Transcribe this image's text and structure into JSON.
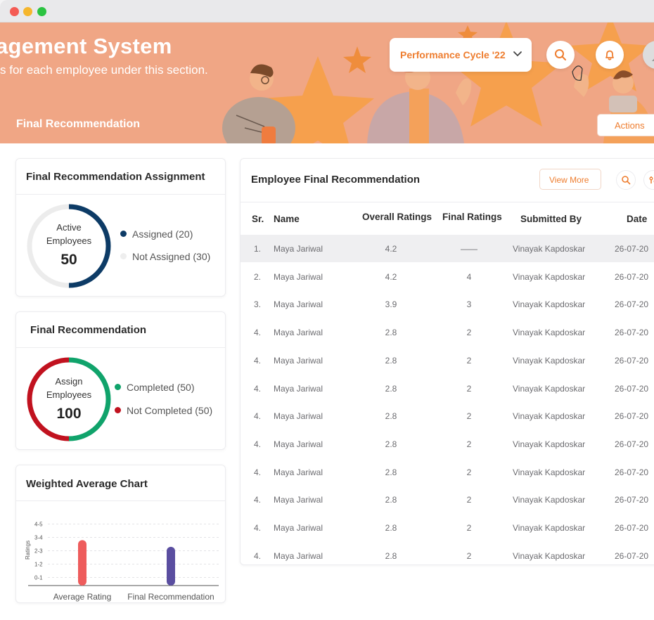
{
  "window": {
    "dots": [
      "#f45b54",
      "#f5b62d",
      "#2bc341"
    ]
  },
  "hero": {
    "title": "agement System",
    "subtitle": "s for each employee under this section.",
    "section_title": "Final Recommendation",
    "cycle_label": "Performance Cycle '22",
    "actions_label": "Actions"
  },
  "assignment": {
    "title": "Final Recommendation Assignment",
    "center_label_1": "Active",
    "center_label_2": "Employees",
    "center_value": "50",
    "legend": [
      {
        "label": "Assigned (20)",
        "color": "#0d3b66"
      },
      {
        "label": "Not Assigned (30)",
        "color": "#eeeeee"
      }
    ],
    "assigned_fraction": 0.5
  },
  "recommendation": {
    "title": "Final Recommendation",
    "center_label_1": "Assign",
    "center_label_2": "Employees",
    "center_value": "100",
    "legend": [
      {
        "label": "Completed (50)",
        "color": "#10a36b"
      },
      {
        "label": "Not Completed (50)",
        "color": "#c1121f"
      }
    ],
    "completed_fraction": 0.5
  },
  "weighted": {
    "title": "Weighted Average Chart"
  },
  "chart_data": {
    "type": "bar",
    "categories": [
      "Average Rating",
      "Final Recommendation"
    ],
    "values": [
      3.4,
      2.9
    ],
    "colors": [
      "#ee5c5c",
      "#5a4ea0"
    ],
    "ylabel": "Ratings",
    "yticks": [
      "0-1",
      "1-2",
      "2-3",
      "3-4",
      "4-5"
    ],
    "ylim": [
      0,
      5
    ],
    "grid": true
  },
  "table": {
    "title": "Employee Final Recommendation",
    "view_more": "View More",
    "headers": [
      "Sr.",
      "Name",
      "Overall Ratings",
      "Final Ratings",
      "Submitted By",
      "Date"
    ],
    "rows": [
      [
        "1.",
        "Maya Jariwal",
        "4.2",
        "——",
        "Vinayak Kapdoskar",
        "26-07-20"
      ],
      [
        "2.",
        "Maya Jariwal",
        "4.2",
        "4",
        "Vinayak Kapdoskar",
        "26-07-20"
      ],
      [
        "3.",
        "Maya Jariwal",
        "3.9",
        "3",
        "Vinayak Kapdoskar",
        "26-07-20"
      ],
      [
        "4.",
        "Maya Jariwal",
        "2.8",
        "2",
        "Vinayak Kapdoskar",
        "26-07-20"
      ],
      [
        "4.",
        "Maya Jariwal",
        "2.8",
        "2",
        "Vinayak Kapdoskar",
        "26-07-20"
      ],
      [
        "4.",
        "Maya Jariwal",
        "2.8",
        "2",
        "Vinayak Kapdoskar",
        "26-07-20"
      ],
      [
        "4.",
        "Maya Jariwal",
        "2.8",
        "2",
        "Vinayak Kapdoskar",
        "26-07-20"
      ],
      [
        "4.",
        "Maya Jariwal",
        "2.8",
        "2",
        "Vinayak Kapdoskar",
        "26-07-20"
      ],
      [
        "4.",
        "Maya Jariwal",
        "2.8",
        "2",
        "Vinayak Kapdoskar",
        "26-07-20"
      ],
      [
        "4.",
        "Maya Jariwal",
        "2.8",
        "2",
        "Vinayak Kapdoskar",
        "26-07-20"
      ],
      [
        "4.",
        "Maya Jariwal",
        "2.8",
        "2",
        "Vinayak Kapdoskar",
        "26-07-20"
      ],
      [
        "4.",
        "Maya Jariwal",
        "2.8",
        "2",
        "Vinayak Kapdoskar",
        "26-07-20"
      ]
    ]
  }
}
